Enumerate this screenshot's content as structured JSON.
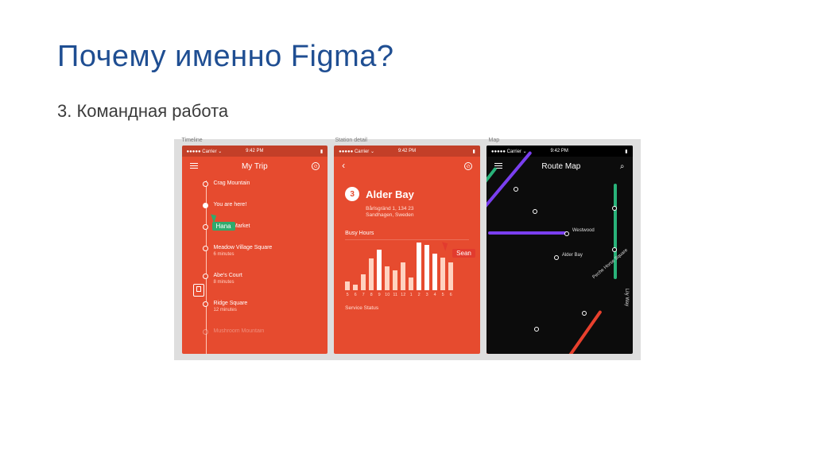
{
  "slide": {
    "title": "Почему именно Figma?",
    "subtitle": "3. Командная работа"
  },
  "frame_labels": {
    "a": "Timeline",
    "b": "Station detail",
    "c": "Map"
  },
  "status": {
    "carrier": "●●●●● Carrier ⌄",
    "time": "9:42 PM",
    "batt": "▮"
  },
  "screens": {
    "trip": {
      "title": "My Trip",
      "stops": [
        {
          "name": "Crag Mountain",
          "sub": ""
        },
        {
          "name": "You are here!",
          "sub": ""
        },
        {
          "name": "Iceland Market",
          "sub": ""
        },
        {
          "name": "Meadow Village Square",
          "sub": "6 minutes"
        },
        {
          "name": "Abe's Court",
          "sub": "8 minutes"
        },
        {
          "name": "Ridge Square",
          "sub": "12 minutes"
        },
        {
          "name": "Mushroom Mountain",
          "sub": ""
        }
      ]
    },
    "detail": {
      "number": "3",
      "name": "Alder Bay",
      "addr1": "Bårlsgränd 1, 134 23",
      "addr2": "Sandhagen, Sweden",
      "busy_title": "Busy Hours",
      "service_title": "Service Status",
      "hours": [
        "5",
        "6",
        "7",
        "8",
        "9",
        "10",
        "11",
        "12",
        "1",
        "2",
        "3",
        "4",
        "5",
        "6"
      ]
    },
    "map": {
      "title": "Route Map",
      "labels": {
        "westwood": "Westwood",
        "alder": "Alder Bay",
        "peche": "Peche Horse Square",
        "lily": "Lily Way"
      }
    }
  },
  "cursors": {
    "a": "Hana",
    "b": "Sean"
  },
  "chart_data": {
    "type": "bar",
    "title": "Busy Hours",
    "categories": [
      "5",
      "6",
      "7",
      "8",
      "9",
      "10",
      "11",
      "12",
      "1",
      "2",
      "3",
      "4",
      "5",
      "6"
    ],
    "values": [
      12,
      8,
      22,
      45,
      58,
      34,
      28,
      40,
      18,
      68,
      64,
      52,
      46,
      40
    ],
    "ylim": [
      0,
      70
    ],
    "xlabel": "",
    "ylabel": ""
  },
  "colors": {
    "orange": "#e64b2f",
    "black": "#0c0c0c",
    "purple": "#7a3ff0",
    "green": "#29b37a",
    "red": "#e8402d"
  }
}
